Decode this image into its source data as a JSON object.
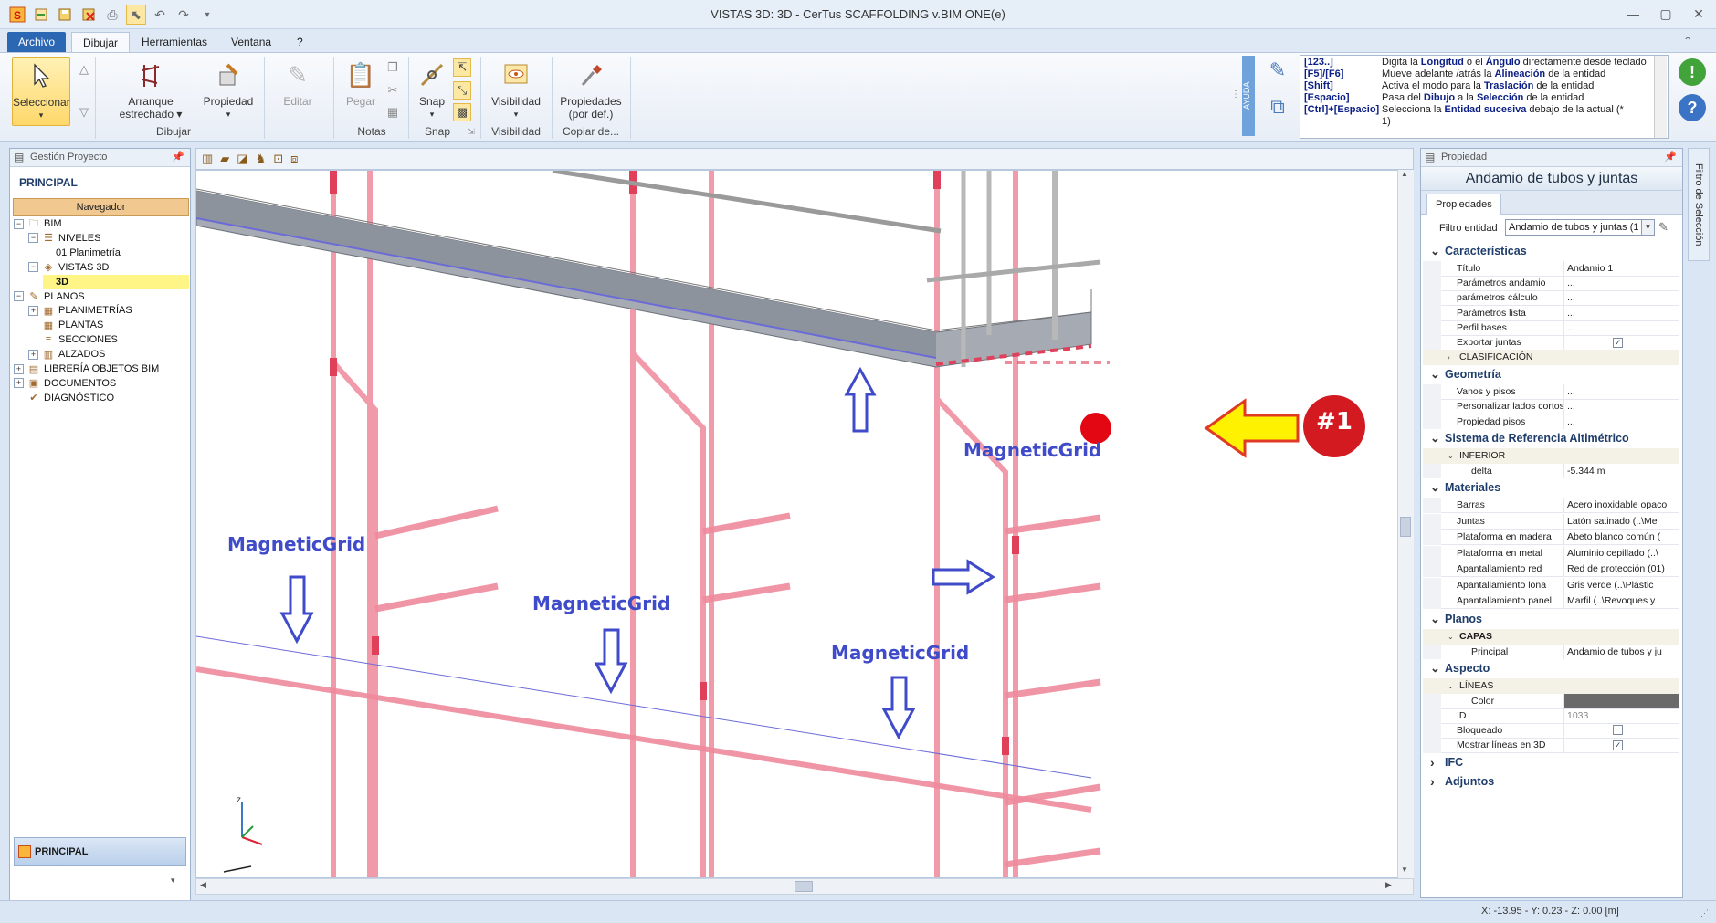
{
  "window": {
    "title": "VISTAS 3D: 3D - CerTus SCAFFOLDING v.BIM ONE(e)"
  },
  "tabs": [
    "Archivo",
    "Dibujar",
    "Herramientas",
    "Ventana",
    "?"
  ],
  "ribbon": {
    "seleccionar": "Seleccionar",
    "arranque": [
      "Arranque",
      "estrechado"
    ],
    "propiedad": "Propiedad",
    "editar": "Editar",
    "dibujar_group": "Dibujar",
    "pegar": "Pegar",
    "notas_group": "Notas",
    "snap": "Snap",
    "snap_group": "Snap",
    "visibilidad": "Visibilidad",
    "visibilidad_group": "Visibilidad",
    "propiedades": [
      "Propiedades",
      "(por def.)"
    ],
    "copiar_group": "Copiar de..."
  },
  "help": {
    "tab": "AYUDA",
    "rows": [
      {
        "key": "[123..]",
        "parts": [
          "Digita la ",
          "Longitud",
          " o el ",
          "Ángulo",
          " directamente desde teclado"
        ]
      },
      {
        "key": "[F5]/[F6]",
        "parts": [
          "Mueve adelante /atrás la ",
          "Alineación",
          " de la entidad"
        ]
      },
      {
        "key": "[Shift]",
        "parts": [
          "Activa el modo para la ",
          "Traslación",
          " de la entidad"
        ]
      },
      {
        "key": "[Espacio]",
        "parts": [
          "Pasa del ",
          "Dibujo",
          " a la ",
          "Selección",
          " de la entidad"
        ]
      },
      {
        "key": "[Ctrl]+[Espacio]",
        "parts": [
          "Selecciona la ",
          "Entidad sucesiva",
          " debajo de la actual (*"
        ]
      },
      {
        "key": "",
        "parts": [
          "1)"
        ]
      }
    ]
  },
  "left_panel": {
    "header": "Gestión Proyecto",
    "title": "PRINCIPAL",
    "navigator": "Navegador",
    "tree": [
      {
        "label": "BIM",
        "level": 0,
        "exp": "−",
        "icon": "folder-icon"
      },
      {
        "label": "NIVELES",
        "level": 1,
        "exp": "−",
        "icon": "levels-icon"
      },
      {
        "label": "01 Planimetría",
        "level": 2,
        "exp": "",
        "icon": ""
      },
      {
        "label": "VISTAS 3D",
        "level": 1,
        "exp": "−",
        "icon": "3d-view-icon"
      },
      {
        "label": "3D",
        "level": 2,
        "exp": "",
        "icon": "",
        "selected": true
      },
      {
        "label": "PLANOS",
        "level": 0,
        "exp": "−",
        "icon": "plans-icon"
      },
      {
        "label": "PLANIMETRÍAS",
        "level": 1,
        "exp": "+",
        "icon": "plan-icon"
      },
      {
        "label": "PLANTAS",
        "level": 1,
        "exp": "",
        "icon": "plan-icon"
      },
      {
        "label": "SECCIONES",
        "level": 1,
        "exp": "",
        "icon": "section-icon"
      },
      {
        "label": "ALZADOS",
        "level": 1,
        "exp": "+",
        "icon": "elevation-icon"
      },
      {
        "label": "LIBRERÍA OBJETOS BIM",
        "level": 0,
        "exp": "+",
        "icon": "library-icon"
      },
      {
        "label": "DOCUMENTOS",
        "level": 0,
        "exp": "+",
        "icon": "documents-icon"
      },
      {
        "label": "DIAGNÓSTICO",
        "level": 0,
        "exp": "",
        "icon": "diagnostic-icon"
      }
    ],
    "bottom": "PRINCIPAL"
  },
  "viewport": {
    "labels": [
      "MagneticGrid",
      "MagneticGrid",
      "MagneticGrid",
      "MagneticGrid"
    ],
    "callout": "#1"
  },
  "properties": {
    "header": "Propiedad",
    "title": "Andamio de tubos y juntas",
    "tab": "Propiedades",
    "filter_label": "Filtro entidad",
    "filter_value": "Andamio de tubos y juntas (1",
    "rows": [
      {
        "type": "cat",
        "label": "Características"
      },
      {
        "type": "row",
        "k": "Título",
        "v": "Andamio 1"
      },
      {
        "type": "row",
        "k": "Parámetros andamio",
        "v": "..."
      },
      {
        "type": "row",
        "k": "parámetros cálculo",
        "v": "..."
      },
      {
        "type": "row",
        "k": "Parámetros lista",
        "v": "..."
      },
      {
        "type": "row",
        "k": "Perfil bases",
        "v": "..."
      },
      {
        "type": "check",
        "k": "Exportar juntas",
        "v": "✓"
      },
      {
        "type": "sub",
        "label": "CLASIFICACIÓN",
        "collapsed": true
      },
      {
        "type": "cat",
        "label": "Geometría"
      },
      {
        "type": "row",
        "k": "Vanos y pisos",
        "v": "..."
      },
      {
        "type": "row",
        "k": "Personalizar lados cortos",
        "v": "..."
      },
      {
        "type": "row",
        "k": "Propiedad pisos",
        "v": "..."
      },
      {
        "type": "cat",
        "label": "Sistema de Referencia Altimétrico"
      },
      {
        "type": "sub",
        "label": "INFERIOR"
      },
      {
        "type": "row2",
        "k": "delta",
        "v": "-5.344 m"
      },
      {
        "type": "cat",
        "label": "Materiales"
      },
      {
        "type": "row",
        "k": "Barras",
        "v": "Acero inoxidable opaco"
      },
      {
        "type": "row",
        "k": "Juntas",
        "v": "Latón satinado   (..\\Me"
      },
      {
        "type": "row",
        "k": "Plataforma en madera",
        "v": "Abeto blanco común   ("
      },
      {
        "type": "row",
        "k": "Plataforma en metal",
        "v": "Aluminio cepillado   (..\\"
      },
      {
        "type": "row",
        "k": "Apantallamiento red",
        "v": "Red de protección (01)"
      },
      {
        "type": "row",
        "k": "Apantallamiento lona",
        "v": "Gris verde   (..\\Plástic"
      },
      {
        "type": "row",
        "k": "Apantallamiento panel",
        "v": "Marfil   (..\\Revoques y"
      },
      {
        "type": "cat",
        "label": "Planos"
      },
      {
        "type": "sub",
        "label": "CAPAS",
        "bold": true
      },
      {
        "type": "row2",
        "k": "Principal",
        "v": "Andamio de tubos y ju"
      },
      {
        "type": "cat",
        "label": "Aspecto"
      },
      {
        "type": "sub",
        "label": "LÍNEAS"
      },
      {
        "type": "color",
        "k": "Color",
        "v": "#6a6a6a"
      },
      {
        "type": "rowgrey",
        "k": "ID",
        "v": "1033"
      },
      {
        "type": "check",
        "k": "Bloqueado",
        "v": ""
      },
      {
        "type": "check",
        "k": "Mostrar líneas en 3D",
        "v": "✓"
      },
      {
        "type": "catc",
        "label": "IFC"
      },
      {
        "type": "catc",
        "label": "Adjuntos"
      }
    ]
  },
  "side_tab": "Filtro de Selección",
  "status": {
    "coords": "X: -13.95 - Y: 0.23 - Z: 0.00 [m]"
  }
}
